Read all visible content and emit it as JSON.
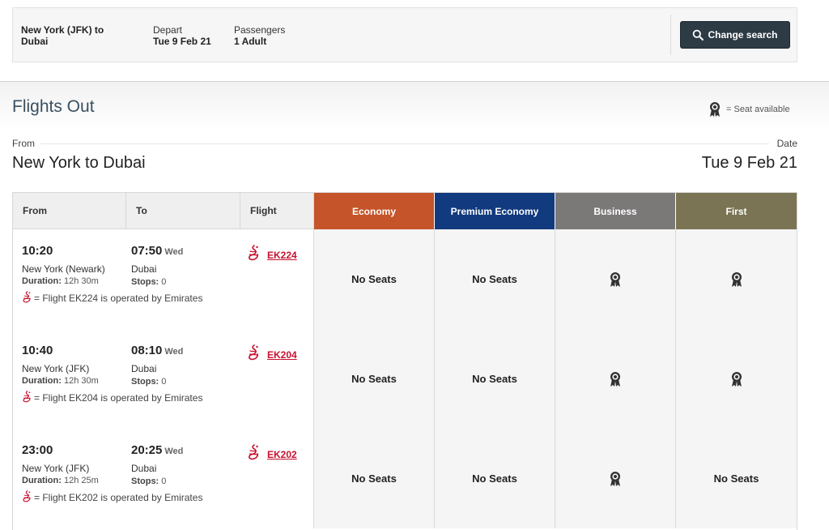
{
  "search": {
    "route": "New York (JFK)  to Dubai",
    "depart_label": "Depart",
    "depart_value": "Tue 9 Feb 21",
    "passengers_label": "Passengers",
    "passengers_value": "1 Adult",
    "change_button": "Change search"
  },
  "section": {
    "title": "Flights Out",
    "legend": "= Seat available",
    "from_label": "From",
    "date_label": "Date",
    "route": "New York to Dubai",
    "date": "Tue 9 Feb 21"
  },
  "table": {
    "headers": {
      "from": "From",
      "to": "To",
      "flight": "Flight",
      "economy": "Economy",
      "premium": "Premium Economy",
      "business": "Business",
      "first": "First"
    },
    "rows": [
      {
        "dep_time": "10:20",
        "arr_time": "07:50",
        "arr_day": "Wed",
        "dep_city": "New York (Newark)",
        "arr_city": "Dubai",
        "duration_label": "Duration:",
        "duration": "12h 30m",
        "stops_label": "Stops:",
        "stops": "0",
        "operated": "= Flight EK224 is operated by Emirates",
        "flight_prefix": "EK",
        "flight_no": "224",
        "economy": "No Seats",
        "premium": "No Seats",
        "business": "seat-available",
        "first": "seat-available"
      },
      {
        "dep_time": "10:40",
        "arr_time": "08:10",
        "arr_day": "Wed",
        "dep_city": "New York (JFK)",
        "arr_city": "Dubai",
        "duration_label": "Duration:",
        "duration": "12h 30m",
        "stops_label": "Stops:",
        "stops": "0",
        "operated": "= Flight EK204 is operated by Emirates",
        "flight_prefix": "EK",
        "flight_no": "204",
        "economy": "No Seats",
        "premium": "No Seats",
        "business": "seat-available",
        "first": "seat-available"
      },
      {
        "dep_time": "23:00",
        "arr_time": "20:25",
        "arr_day": "Wed",
        "dep_city": "New York (JFK)",
        "arr_city": "Dubai",
        "duration_label": "Duration:",
        "duration": "12h 25m",
        "stops_label": "Stops:",
        "stops": "0",
        "operated": "= Flight EK202 is operated by Emirates",
        "flight_prefix": "EK",
        "flight_no": "202",
        "economy": "No Seats",
        "premium": "No Seats",
        "business": "seat-available",
        "first": "No Seats"
      }
    ]
  },
  "colors": {
    "economy": "#c5542a",
    "premium": "#123a7e",
    "business": "#7b7878",
    "first": "#7a7454",
    "emirates_red": "#c8102e",
    "title": "#3a5060",
    "button": "#2d3b45"
  },
  "icons": {
    "seat_available": "award-ribbon-icon",
    "airline": "emirates-logo-icon",
    "search": "search-icon"
  }
}
